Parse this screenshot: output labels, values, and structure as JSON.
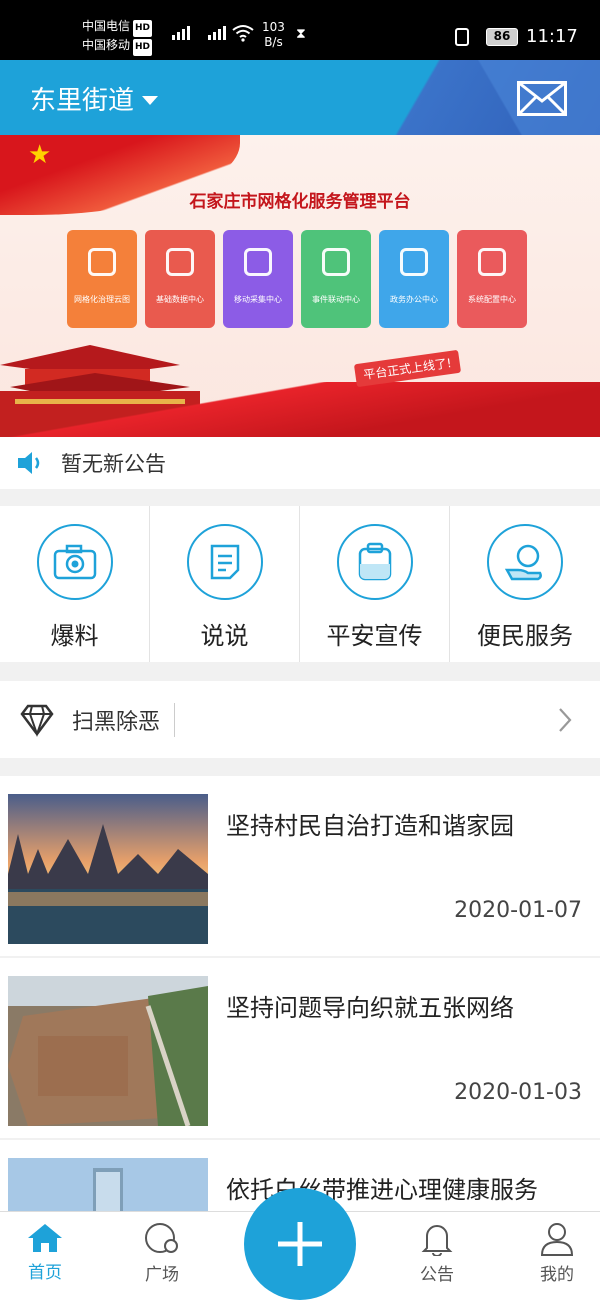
{
  "status_bar": {
    "carrier1": "中国电信",
    "carrier2": "中国移动",
    "hd": "HD",
    "net_speed_value": "103",
    "net_speed_unit": "B/s",
    "battery": "86",
    "time": "11:17"
  },
  "header": {
    "location": "东里街道"
  },
  "banner": {
    "title": "石家庄市网格化服务管理平台",
    "modules": [
      {
        "label": "网格化治理云图",
        "color": "#f4803a"
      },
      {
        "label": "基础数据中心",
        "color": "#e95a4e"
      },
      {
        "label": "移动采集中心",
        "color": "#8c5ce6"
      },
      {
        "label": "事件联动中心",
        "color": "#4fc37a"
      },
      {
        "label": "政务办公中心",
        "color": "#3fa6ea"
      },
      {
        "label": "系统配置中心",
        "color": "#ea5a5c"
      }
    ],
    "tag": "平台正式上线了!"
  },
  "notice": {
    "text": "暂无新公告"
  },
  "quick_actions": [
    {
      "label": "爆料",
      "icon": "camera-icon"
    },
    {
      "label": "说说",
      "icon": "note-icon"
    },
    {
      "label": "平安宣传",
      "icon": "clipboard-icon"
    },
    {
      "label": "便民服务",
      "icon": "hand-heart-icon"
    }
  ],
  "crime_section": {
    "title": "扫黑除恶"
  },
  "news": [
    {
      "title": "坚持村民自治打造和谐家园",
      "date": "2020-01-07"
    },
    {
      "title": "坚持问题导向织就五张网络",
      "date": "2020-01-03"
    },
    {
      "title": "依托白丝带推进心理健康服务",
      "date": ""
    }
  ],
  "tabbar": {
    "home": "首页",
    "square": "广场",
    "notice": "公告",
    "mine": "我的"
  },
  "colors": {
    "primary": "#1ea2d9",
    "header_dark": "#2f5fb8"
  }
}
